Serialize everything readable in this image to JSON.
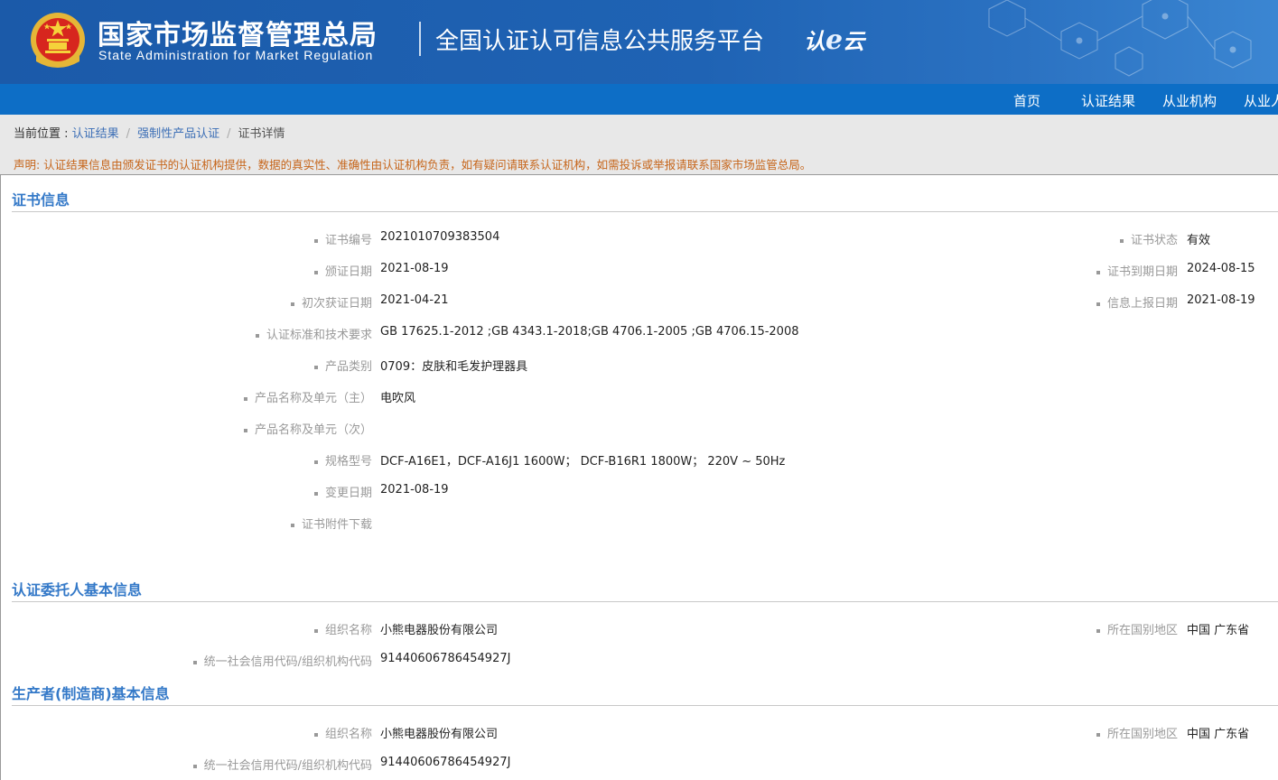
{
  "header": {
    "org_cn": "国家市场监督管理总局",
    "org_en": "State Administration  for  Market Regulation",
    "platform": "全国认证认可信息公共服务平台",
    "logo_a": "认",
    "logo_b": "e",
    "logo_c": "云"
  },
  "nav": {
    "items": [
      "首页",
      "认证结果",
      "从业机构",
      "从业人"
    ]
  },
  "breadcrumb": {
    "prefix": "当前位置 : ",
    "items": [
      "认证结果",
      "强制性产品认证",
      "证书详情"
    ]
  },
  "notice": "声明: 认证结果信息由颁发证书的认证机构提供，数据的真实性、准确性由认证机构负责，如有疑问请联系认证机构，如需投诉或举报请联系国家市场监管总局。",
  "cert": {
    "title": "证书信息",
    "left": [
      {
        "label": "证书编号",
        "value": "2021010709383504"
      },
      {
        "label": "颁证日期",
        "value": "2021-08-19"
      },
      {
        "label": "初次获证日期",
        "value": "2021-04-21"
      },
      {
        "label": "认证标准和技术要求",
        "value": "GB 17625.1-2012 ;GB 4343.1-2018;GB 4706.1-2005 ;GB 4706.15-2008"
      },
      {
        "label": "产品类别",
        "value": "0709：皮肤和毛发护理器具"
      },
      {
        "label": "产品名称及单元（主）",
        "value": "电吹风"
      },
      {
        "label": "产品名称及单元（次）",
        "value": ""
      },
      {
        "label": "规格型号",
        "value": "DCF-A16E1，DCF-A16J1 1600W；  DCF-B16R1 1800W；  220V ~  50Hz"
      },
      {
        "label": "变更日期",
        "value": "2021-08-19"
      },
      {
        "label": "证书附件下载",
        "value": ""
      }
    ],
    "right": [
      {
        "label": "证书状态",
        "value": "有效"
      },
      {
        "label": "证书到期日期",
        "value": "2024-08-15"
      },
      {
        "label": "信息上报日期",
        "value": "2021-08-19"
      }
    ]
  },
  "applicant": {
    "title": "认证委托人基本信息",
    "org_label": "组织名称",
    "org_value": "小熊电器股份有限公司",
    "code_label": "统一社会信用代码/组织机构代码",
    "code_value": "91440606786454927J",
    "region_label": "所在国别地区",
    "region_value": "中国 广东省"
  },
  "manufacturer": {
    "title": "生产者(制造商)基本信息",
    "org_label": "组织名称",
    "org_value": "小熊电器股份有限公司",
    "code_label": "统一社会信用代码/组织机构代码",
    "code_value": "91440606786454927J",
    "region_label": "所在国别地区",
    "region_value": "中国 广东省"
  },
  "colors": {
    "header_blue": "#1f63b4",
    "nav_blue": "#0d6ec6",
    "section_title": "#3479c8",
    "notice_orange": "#c6651a"
  },
  "icons": {
    "emblem": "national-emblem-icon",
    "label_bullet": "square-bullet-icon"
  }
}
